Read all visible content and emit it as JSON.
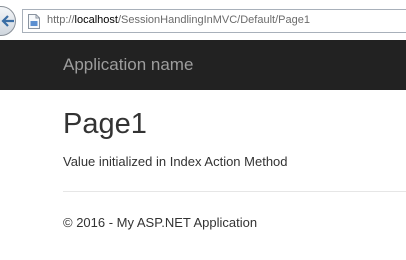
{
  "browser": {
    "url_scheme": "http://",
    "url_host": "localhost",
    "url_path": "/SessionHandlingInMVC/Default/Page1"
  },
  "navbar": {
    "brand": "Application name",
    "background": "#222222",
    "brand_color": "#9d9d9d"
  },
  "main": {
    "title": "Page1",
    "message": "Value initialized in Index Action Method"
  },
  "footer": {
    "text": "© 2016 - My ASP.NET Application"
  },
  "icons": {
    "back": "back-arrow-icon",
    "page": "page-icon"
  }
}
